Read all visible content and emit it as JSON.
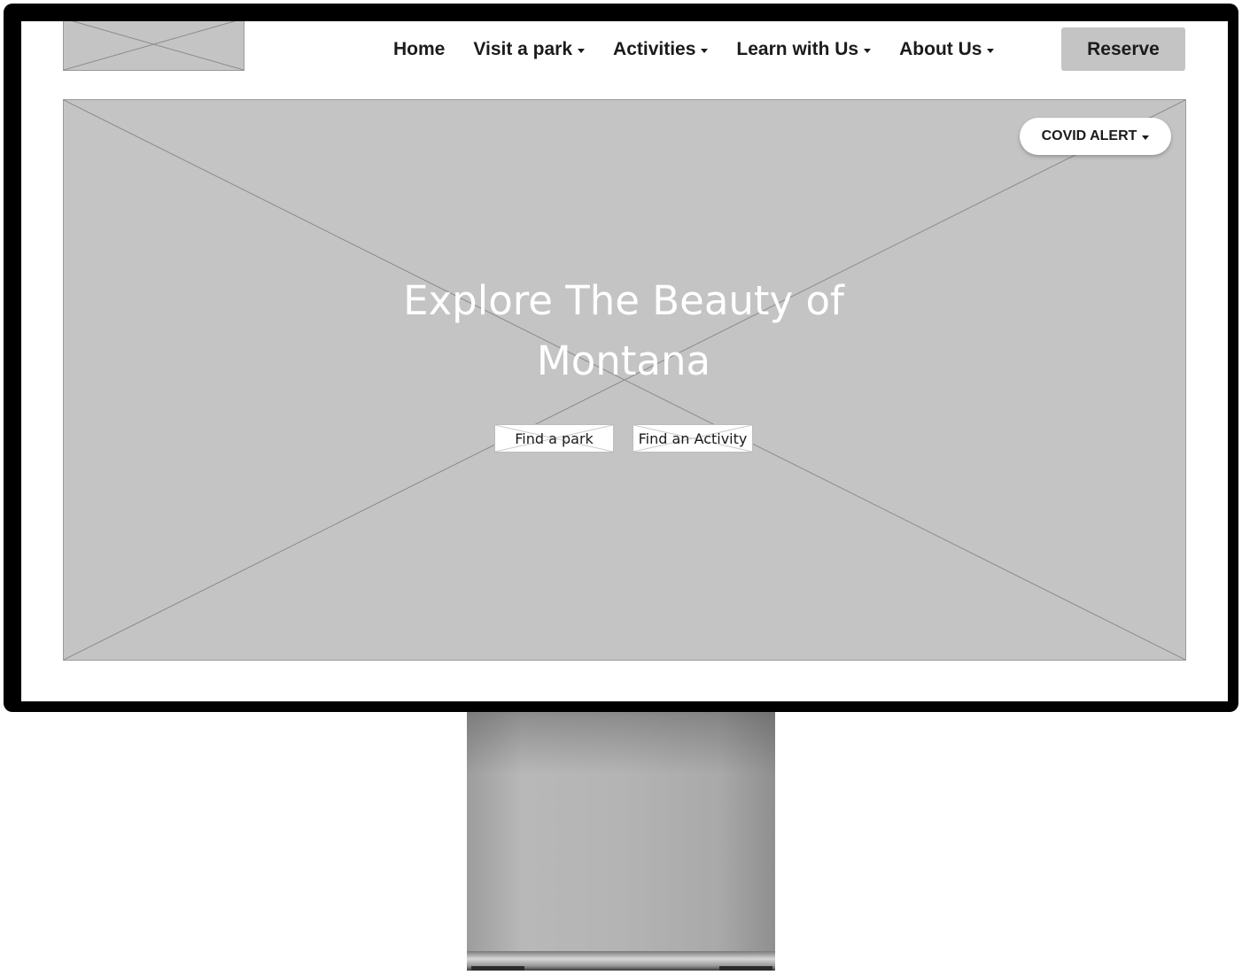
{
  "nav": {
    "items": [
      {
        "label": "Home",
        "dropdown": false
      },
      {
        "label": "Visit a park",
        "dropdown": true
      },
      {
        "label": "Activities",
        "dropdown": true
      },
      {
        "label": "Learn with Us",
        "dropdown": true
      },
      {
        "label": "About Us",
        "dropdown": true
      }
    ],
    "reserve_label": "Reserve"
  },
  "hero": {
    "alert_label": "COVID ALERT",
    "title_line1": "Explore The Beauty of",
    "title_line2": "Montana",
    "find_park_label": "Find a park",
    "find_activity_label": "Find an Activity"
  },
  "colors": {
    "placeholder": "#c4c4c4",
    "bezel": "#000000",
    "text": "#1b1b1b",
    "hero_text": "#ffffff"
  }
}
